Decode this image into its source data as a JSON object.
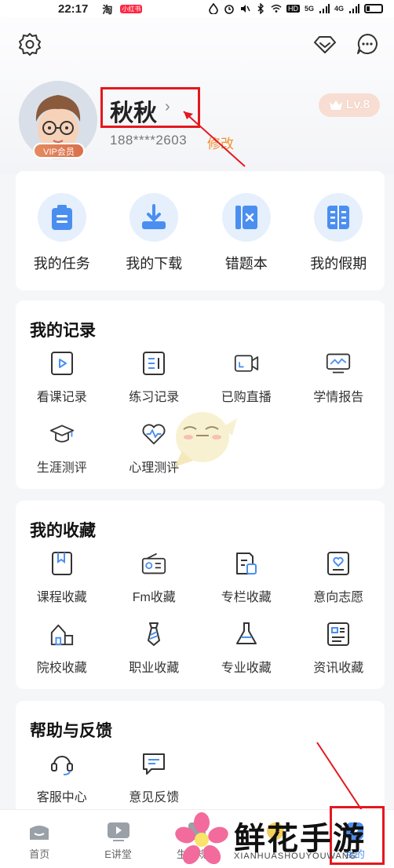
{
  "status_bar": {
    "time": "22:17",
    "apps": [
      "淘",
      "小红书"
    ],
    "net1": "5G",
    "net2": "4G",
    "hd": "HD"
  },
  "profile": {
    "name": "秋秋",
    "phone": "188****2603",
    "edit_label": "修改",
    "vip_label": "VIP会员",
    "level_label": "Lv.8"
  },
  "quick_actions": [
    {
      "label": "我的任务",
      "icon": "clipboard-icon"
    },
    {
      "label": "我的下载",
      "icon": "download-icon"
    },
    {
      "label": "错题本",
      "icon": "wrong-book-icon"
    },
    {
      "label": "我的假期",
      "icon": "holiday-book-icon"
    }
  ],
  "records": {
    "title": "我的记录",
    "items": [
      {
        "label": "看课记录",
        "icon": "play-record-icon"
      },
      {
        "label": "练习记录",
        "icon": "practice-record-icon"
      },
      {
        "label": "已购直播",
        "icon": "live-camera-icon"
      },
      {
        "label": "学情报告",
        "icon": "report-monitor-icon"
      },
      {
        "label": "生涯测评",
        "icon": "graduation-cap-icon"
      },
      {
        "label": "心理测评",
        "icon": "heart-pulse-icon"
      }
    ]
  },
  "favorites": {
    "title": "我的收藏",
    "items": [
      {
        "label": "课程收藏",
        "icon": "course-bookmark-icon"
      },
      {
        "label": "Fm收藏",
        "icon": "radio-icon"
      },
      {
        "label": "专栏收藏",
        "icon": "column-doc-icon"
      },
      {
        "label": "意向志愿",
        "icon": "heart-card-icon"
      },
      {
        "label": "院校收藏",
        "icon": "school-building-icon"
      },
      {
        "label": "职业收藏",
        "icon": "tie-icon"
      },
      {
        "label": "专业收藏",
        "icon": "flask-icon"
      },
      {
        "label": "资讯收藏",
        "icon": "news-card-icon"
      }
    ]
  },
  "help": {
    "title": "帮助与反馈",
    "items": [
      {
        "label": "客服中心",
        "icon": "headset-icon"
      },
      {
        "label": "意见反馈",
        "icon": "feedback-chat-icon"
      }
    ]
  },
  "tabs": [
    {
      "label": "首页",
      "icon": "home-icon"
    },
    {
      "label": "E讲堂",
      "icon": "video-play-icon"
    },
    {
      "label": "生涯规划",
      "icon": "plan-icon"
    },
    {
      "label": "",
      "icon": "discover-icon"
    },
    {
      "label": "我的",
      "icon": "profile-icon"
    }
  ],
  "watermark": {
    "text": "鲜花手游网",
    "subtext": "XIANHUASHOUYOUWANG"
  },
  "colors": {
    "accent_blue": "#4a8ff0",
    "accent_orange": "#f0902f",
    "annotation_red": "#e4181f"
  }
}
